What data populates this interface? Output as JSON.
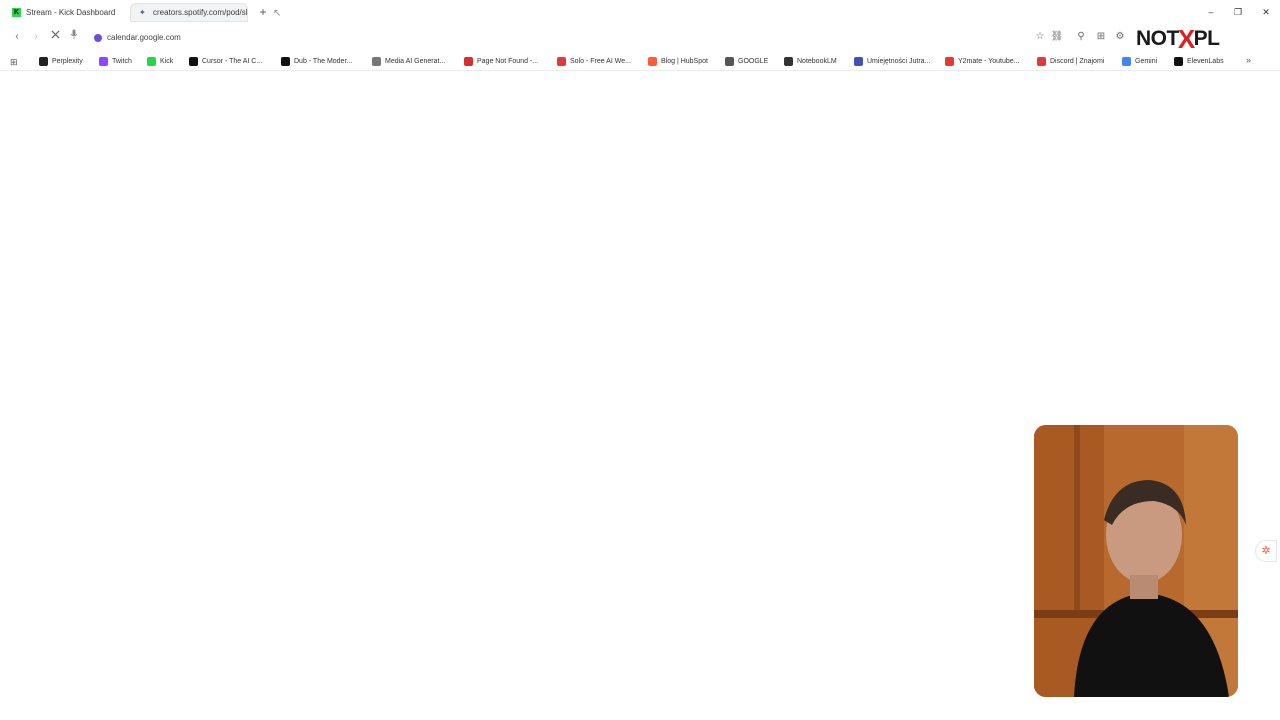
{
  "tabs": [
    {
      "label": "Stream - Kick Dashboard",
      "icon": "kick-icon"
    },
    {
      "label": "creators.spotify.com/pod/sho",
      "icon": "spotify-creators-icon"
    }
  ],
  "window_controls": {
    "minimize": "–",
    "restore": "❐",
    "close": "✕"
  },
  "address_bar": {
    "url": "calendar.google.com"
  },
  "brand_logo": {
    "left": "NOT",
    "x": "X",
    "right": "PL"
  },
  "bookmarks": [
    {
      "label": "Perplexity",
      "icon": "perplexity-icon",
      "color": "#222222"
    },
    {
      "label": "Twitch",
      "icon": "twitch-icon",
      "color": "#9146ff"
    },
    {
      "label": "Kick",
      "icon": "kick-icon",
      "color": "#28d44a"
    },
    {
      "label": "Cursor - The AI C...",
      "icon": "cursor-icon",
      "color": "#111111"
    },
    {
      "label": "Dub - The Moder...",
      "icon": "dub-icon",
      "color": "#111111"
    },
    {
      "label": "Media AI Generat...",
      "icon": "globe-icon",
      "color": "#777777"
    },
    {
      "label": "Page Not Found -...",
      "icon": "error-icon",
      "color": "#d32f2f"
    },
    {
      "label": "Solo - Free AI We...",
      "icon": "solo-icon",
      "color": "#e53935"
    },
    {
      "label": "Blog | HubSpot",
      "icon": "hubspot-icon",
      "color": "#ff5c35"
    },
    {
      "label": "GOOGLE",
      "icon": "folder-icon",
      "color": "#555555"
    },
    {
      "label": "NotebookLM",
      "icon": "notebooklm-icon",
      "color": "#333333"
    },
    {
      "label": "Umiejętności Jutra...",
      "icon": "ai-icon",
      "color": "#3f51b5"
    },
    {
      "label": "Y2mate - Youtube...",
      "icon": "download-icon",
      "color": "#e53935"
    },
    {
      "label": "Discord | Znajomi",
      "icon": "discord-icon",
      "color": "#e53935"
    },
    {
      "label": "Gemini",
      "icon": "gemini-icon",
      "color": "#4285f4"
    },
    {
      "label": "ElevenLabs",
      "icon": "elevenlabs-icon",
      "color": "#111111"
    }
  ]
}
